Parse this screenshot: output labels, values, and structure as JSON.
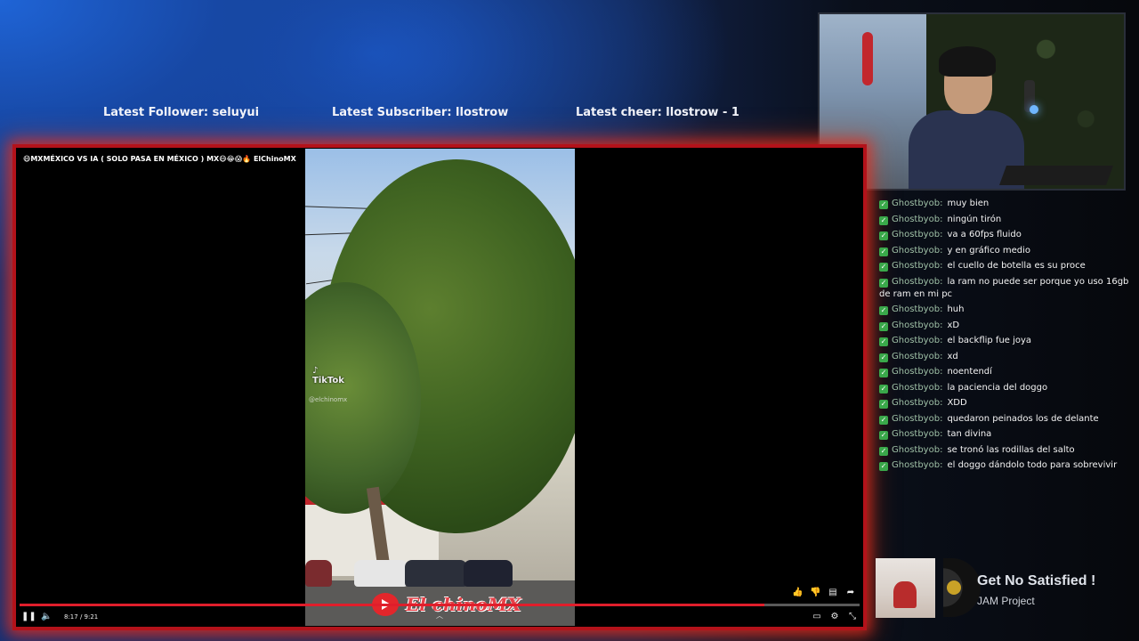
{
  "overlay": {
    "latest_follower": "Latest Follower: seluyui",
    "latest_subscriber": "Latest Subscriber: llostrow",
    "latest_cheer": "Latest cheer: llostrow - 1"
  },
  "player": {
    "title": "😷MXMÉXICO VS IA ( SOLO PASA EN MÉXICO ) MX😷😂😱🔥 ElChinoMX",
    "tiktok_label": "TikTok",
    "tiktok_handle": "@elchinomx",
    "watermark": "El chinoMX",
    "time": "8:17 / 9:21",
    "progress": 0.887,
    "accent_color": "#e01e2b",
    "border_color": "#b3121a"
  },
  "chat": {
    "messages": [
      {
        "user": "Ghostbyob",
        "text": "muy bien"
      },
      {
        "user": "Ghostbyob",
        "text": "ningún tirón"
      },
      {
        "user": "Ghostbyob",
        "text": "va a 60fps fluido"
      },
      {
        "user": "Ghostbyob",
        "text": "y en gráfico medio"
      },
      {
        "user": "Ghostbyob",
        "text": "el cuello de botella es su proce"
      },
      {
        "user": "Ghostbyob",
        "text": "la ram no puede ser porque yo uso 16gb de ram en mi pc"
      },
      {
        "user": "Ghostbyob",
        "text": "huh"
      },
      {
        "user": "Ghostbyob",
        "text": "xD"
      },
      {
        "user": "Ghostbyob",
        "text": "el backflip fue joya"
      },
      {
        "user": "Ghostbyob",
        "text": "xd"
      },
      {
        "user": "Ghostbyob",
        "text": "noentendí"
      },
      {
        "user": "Ghostbyob",
        "text": "la paciencia del doggo"
      },
      {
        "user": "Ghostbyob",
        "text": "XDD"
      },
      {
        "user": "Ghostbyob",
        "text": "quedaron peinados los de delante"
      },
      {
        "user": "Ghostbyob",
        "text": "tan divina"
      },
      {
        "user": "Ghostbyob",
        "text": "se tronó las rodillas del salto"
      },
      {
        "user": "Ghostbyob",
        "text": "el doggo dándolo todo para sobrevivir"
      }
    ]
  },
  "now_playing": {
    "title": "Get No Satisfied !",
    "artist": "JAM Project"
  },
  "icons": {
    "play_pause": "pause-icon",
    "volume": "volume-icon",
    "like": "like-icon",
    "dislike": "dislike-icon",
    "comment": "comment-icon",
    "share": "share-icon",
    "subtitles": "subtitles-icon",
    "settings": "settings-icon",
    "fullscreen": "fullscreen-icon",
    "chat_badge": "verified-badge-icon"
  }
}
